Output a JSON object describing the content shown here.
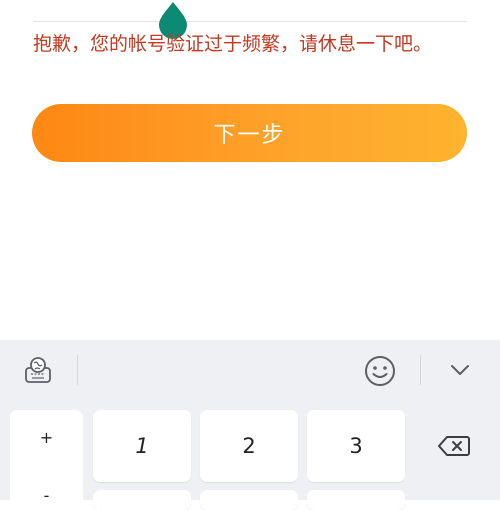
{
  "message": {
    "error_text": "抱歉，您的帐号验证过于频繁，请休息一下吧。"
  },
  "next_button": {
    "label": "下一步"
  },
  "keyboard": {
    "toolbar": {
      "icons": [
        "globe-keyboard-icon",
        "emoji-icon",
        "chevron-down-icon"
      ]
    },
    "keys": {
      "side_plus": "+",
      "side_minus": "-",
      "digit_1": "1",
      "digit_2": "2",
      "digit_3": "3"
    },
    "icons": {
      "backspace": "backspace-icon"
    }
  },
  "colors": {
    "error_text": "#c03a22",
    "button_gradient_start": "#fd8813",
    "button_gradient_end": "#fdb42f",
    "marker": "#0d8a74",
    "keyboard_bg": "#eff0f4"
  }
}
